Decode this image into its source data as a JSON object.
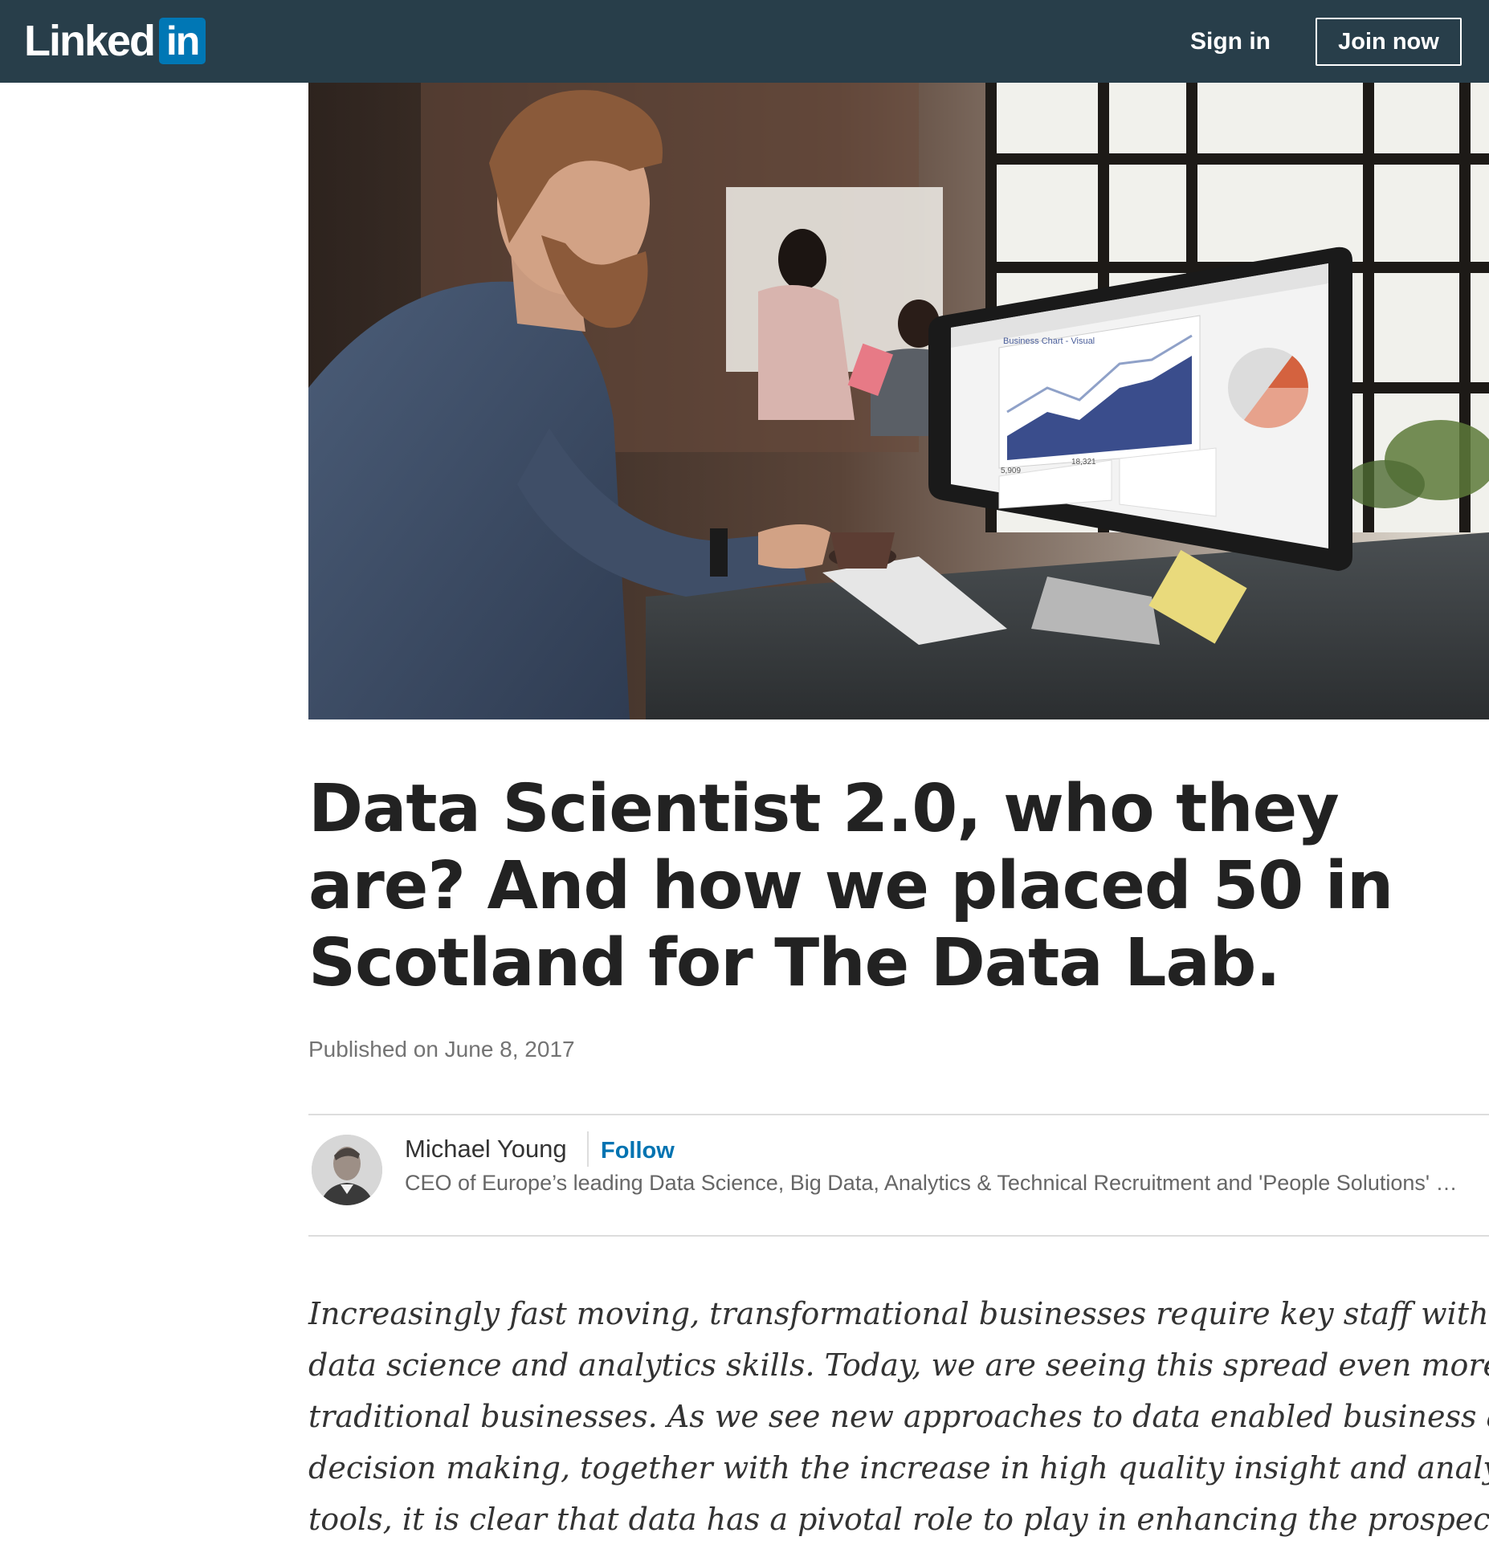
{
  "header": {
    "logo_text": "Linked",
    "logo_box": "in",
    "sign_in": "Sign in",
    "join_now": "Join now",
    "bg_color": "#283e4a",
    "brand_color": "#0077b5"
  },
  "hero": {
    "screen_chart_title": "Business Chart - Visual",
    "screen_value_1": "5,909",
    "screen_value_2": "18,321"
  },
  "article": {
    "title": "Data Scientist 2.0, who they are? And how we placed 50 in Scotland for The Data Lab.",
    "published": "Published on June 8, 2017"
  },
  "author": {
    "name": "Michael Young",
    "follow": "Follow",
    "headline": "CEO of Europe’s leading Data Science, Big Data, Analytics & Technical Recruitment and 'People Solutions' …"
  },
  "body": {
    "lines": [
      "Increasingly fast moving, transformational businesses require key staff with",
      "data science and analytics skills. Today, we are seeing this spread even more to",
      "traditional businesses. As we see new approaches to data enabled business and",
      "decision making, together with the increase in high quality insight and analytics",
      "tools, it is clear that data has a pivotal role to play in enhancing the prospects of"
    ]
  }
}
